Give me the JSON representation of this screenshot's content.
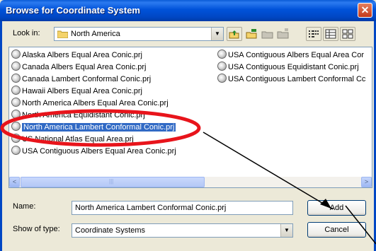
{
  "window": {
    "title": "Browse for Coordinate System",
    "close_glyph": "✕"
  },
  "lookin": {
    "label": "Look in:",
    "value": "North America",
    "icon": "folder-icon"
  },
  "toolbar": {
    "buttons": [
      "up-folder-icon",
      "connect-folder-icon",
      "disconnect-folder-icon",
      "new-folder-icon",
      "list-view-icon",
      "details-view-icon",
      "thumbnails-view-icon"
    ]
  },
  "files": {
    "items": [
      {
        "label": "Alaska Albers Equal Area Conic.prj"
      },
      {
        "label": "Canada Albers Equal Area Conic.prj"
      },
      {
        "label": "Canada Lambert Conformal Conic.prj"
      },
      {
        "label": "Hawaii Albers Equal Area Conic.prj"
      },
      {
        "label": "North America Albers Equal Area Conic.prj"
      },
      {
        "label": "North America Equidistant Conic.prj"
      },
      {
        "label": "North America Lambert Conformal Conic.prj"
      },
      {
        "label": "US National Atlas Equal Area.prj"
      },
      {
        "label": "USA Contiguous Albers Equal Area Conic.prj"
      },
      {
        "label": "USA Contiguous Albers Equal Area Cor"
      },
      {
        "label": "USA Contiguous Equidistant Conic.prj"
      },
      {
        "label": "USA Contiguous Lambert Conformal Cc"
      }
    ],
    "selected": "North America Lambert Conformal Conic.prj"
  },
  "scrollbar": {
    "left_arrow": "<",
    "right_arrow": ">",
    "grip": "|||"
  },
  "name": {
    "label": "Name:",
    "value": "North America Lambert Conformal Conic.prj"
  },
  "type": {
    "label": "Show of type:",
    "value": "Coordinate Systems"
  },
  "buttons": {
    "add": "Add",
    "cancel": "Cancel"
  },
  "annotation": {
    "ellipse_color": "#E8141B",
    "arrow_color": "#000000"
  }
}
